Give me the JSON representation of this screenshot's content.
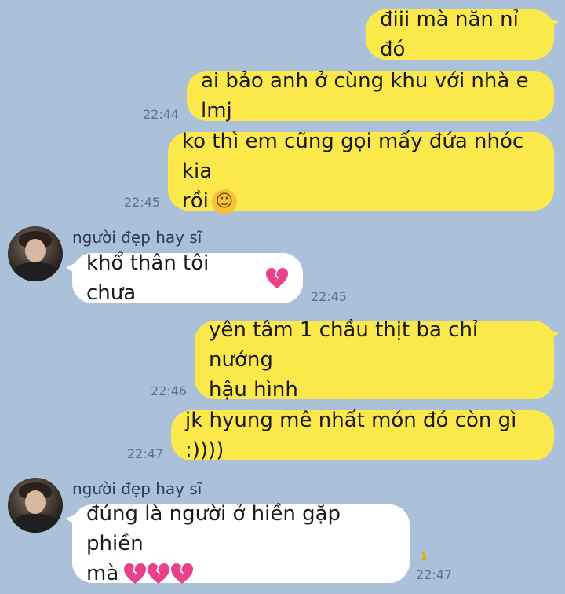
{
  "messages": [
    {
      "text": "điii mà năn nỉ đó"
    },
    {
      "text": "ai bảo anh ở cùng khu với nhà e lmj",
      "time": "22:44"
    },
    {
      "text_line1": "ko thì em cũng gọi mấy đứa nhóc kia",
      "text_line2": "rồi",
      "emoji": "☺",
      "time": "22:45"
    },
    {
      "sender": "người đẹp hay sĩ",
      "text": "khổ thân tôi chưa",
      "time": "22:45"
    },
    {
      "text_line1": "yên tâm 1 chầu thịt ba chỉ nướng",
      "text_line2": "hậu hình",
      "time": "22:46"
    },
    {
      "text": "jk hyung mê nhất món đó còn gì :))))",
      "time": "22:47"
    },
    {
      "sender": "người đẹp hay sĩ",
      "text_line1": "đúng là người ở hiền gặp phiền",
      "text_line2": "mà",
      "time": "22:47",
      "unread": "1"
    }
  ],
  "colors": {
    "background": "#aac1d9",
    "my_bubble": "#fbe94b",
    "their_bubble": "#ffffff",
    "broken_heart": "#e8408a"
  }
}
